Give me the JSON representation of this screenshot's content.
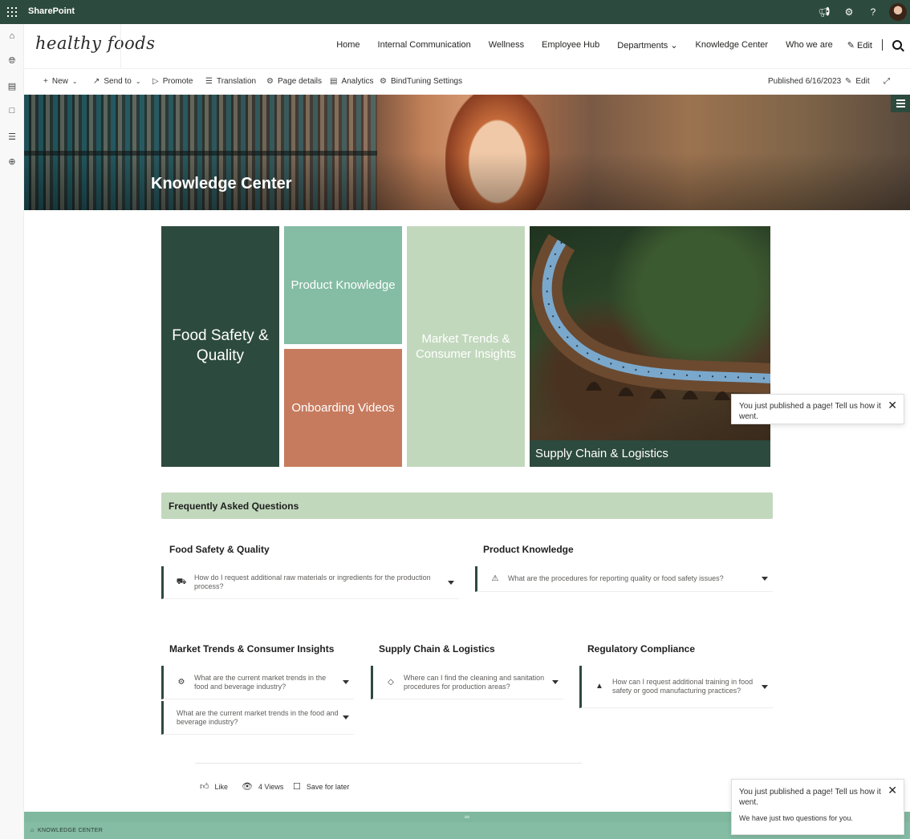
{
  "topbar": {
    "app_name": "SharePoint",
    "icons": [
      "waffle-icon",
      "megaphone-icon",
      "gear-icon",
      "help-icon",
      "avatar"
    ]
  },
  "site": {
    "logo_text": "healthy foods",
    "nav": [
      "Home",
      "Internal Communication",
      "Wellness",
      "Employee Hub",
      "Departments ⌄",
      "Knowledge Center",
      "Who we are"
    ],
    "edit_label": "✎ Edit"
  },
  "commandbar": {
    "new": "New",
    "send_to": "Send to",
    "promote": "Promote",
    "translation": "Translation",
    "page_details": "Page details",
    "analytics": "Analytics",
    "bindtuning": "BindTuning Settings",
    "published": "Published 6/16/2023",
    "edit": "Edit"
  },
  "hero": {
    "title": "Knowledge Center"
  },
  "tiles": {
    "food_safety": "Food Safety & Quality",
    "product_knowledge": "Product Knowledge",
    "onboarding_videos": "Onboarding Videos",
    "market_trends": "Market Trends & Consumer Insights",
    "supply_chain": "Supply Chain & Logistics"
  },
  "faq": {
    "header": "Frequently Asked Questions",
    "sections": {
      "food_safety": {
        "title": "Food Safety & Quality",
        "q1": "How do I request additional raw materials or ingredients for the production process?"
      },
      "product_knowledge": {
        "title": "Product Knowledge",
        "q1": "What are the procedures for reporting quality or food safety issues?"
      },
      "market_trends": {
        "title": "Market Trends & Consumer Insights",
        "q1": "What are the current market trends in the food and beverage industry?",
        "q2": "What are the current market trends in the food and beverage industry?"
      },
      "supply_chain": {
        "title": "Supply Chain & Logistics",
        "q1": "Where can I find the cleaning and sanitation procedures for production areas?"
      },
      "regulatory": {
        "title": "Regulatory Compliance",
        "q1": "How can I request additional training in food safety or good manufacturing practices?"
      }
    }
  },
  "social": {
    "like": "Like",
    "views": "4 Views",
    "save": "Save for later"
  },
  "toasts": {
    "message": "You just published a page! Tell us how it went.",
    "sub": "We have just two questions for you."
  },
  "footer": {
    "breadcrumb": "KNOWLEDGE CENTER",
    "handle": "═"
  }
}
